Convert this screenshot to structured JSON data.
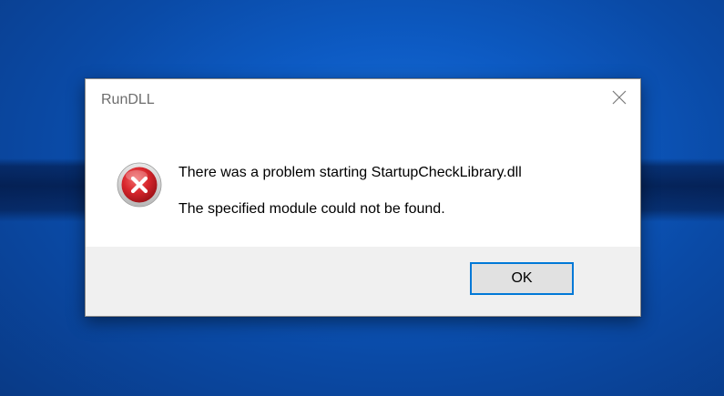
{
  "dialog": {
    "title": "RunDLL",
    "close_icon": "close-icon",
    "error_icon": "error-icon",
    "message_primary": "There was a problem starting StartupCheckLibrary.dll",
    "message_secondary": "The specified module could not be found.",
    "ok_label": "OK"
  },
  "colors": {
    "desktop": "#0d5bc4",
    "accent": "#0078d7",
    "error_red": "#d8262c",
    "footer": "#f0f0f0"
  }
}
